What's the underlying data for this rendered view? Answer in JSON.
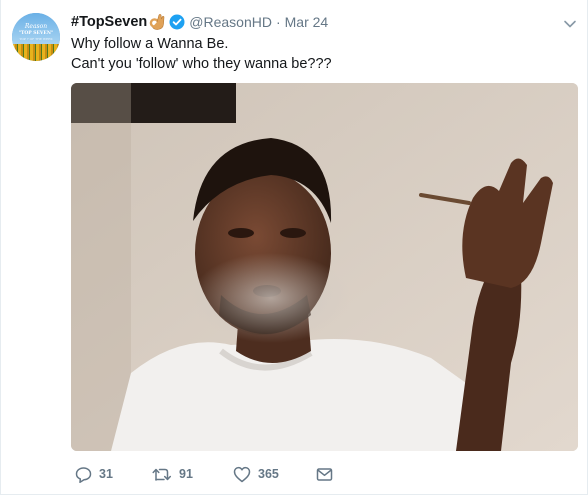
{
  "tweet": {
    "avatar": {
      "line1": "Reason",
      "line2": "\"TOP SEVEN\"",
      "line3": "TOP 7 OF THE WEEK"
    },
    "author": {
      "name": "#TopSeven",
      "name_emoji": "ok-hand-icon",
      "verified_icon": "verified-badge-icon",
      "handle": "@ReasonHD",
      "separator": "·",
      "date": "Mar 24"
    },
    "text_lines": [
      "Why follow a Wanna Be.",
      "Can't you 'follow' who they wanna be???"
    ],
    "media": {
      "description_icon": "photo-image"
    },
    "actions": {
      "reply_count": "31",
      "retweet_count": "91",
      "like_count": "365",
      "reply_icon": "reply-icon",
      "retweet_icon": "retweet-icon",
      "like_icon": "heart-icon",
      "dm_icon": "envelope-icon"
    },
    "colors": {
      "text": "#14171a",
      "muted": "#657786",
      "verified": "#1da1f2",
      "border": "#e6ecf0"
    }
  }
}
